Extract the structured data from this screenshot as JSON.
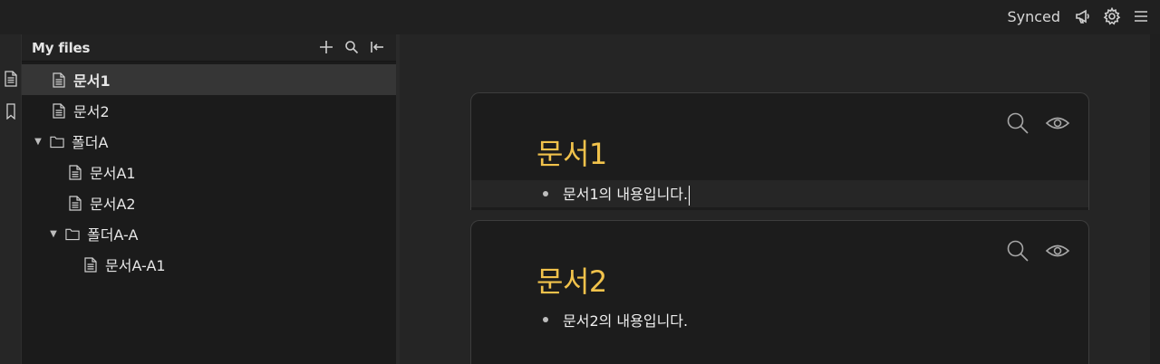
{
  "topbar": {
    "status": "Synced",
    "icons": [
      "megaphone-icon",
      "gear-icon",
      "hamburger-menu-icon"
    ]
  },
  "rail": {
    "icons": [
      "file-list-icon",
      "bookmark-icon"
    ]
  },
  "sidebar": {
    "title": "My files",
    "actions": [
      "plus-icon",
      "search-icon",
      "collapse-sidebar-icon"
    ],
    "tree": [
      {
        "type": "file",
        "label": "문서1",
        "active": true
      },
      {
        "type": "file",
        "label": "문서2"
      },
      {
        "type": "folder",
        "label": "폴더A",
        "expanded": true
      },
      {
        "type": "file",
        "label": "문서A1"
      },
      {
        "type": "file",
        "label": "문서A2"
      },
      {
        "type": "folder",
        "label": "폴더A-A",
        "expanded": true
      },
      {
        "type": "file",
        "label": "문서A-A1"
      }
    ]
  },
  "documents": [
    {
      "title": "문서1",
      "bullet": "문서1의 내용입니다."
    },
    {
      "title": "문서2",
      "bullet": "문서2의 내용입니다."
    }
  ]
}
